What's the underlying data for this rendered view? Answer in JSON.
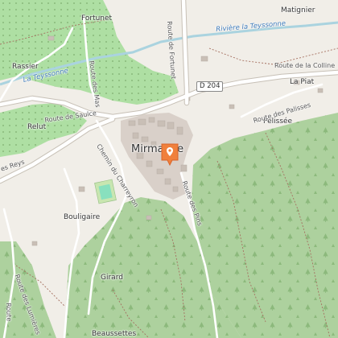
{
  "map": {
    "places": {
      "fortunet": "Fortunet",
      "matignier": "Matignier",
      "rassier": "Rassier",
      "la_piat": "La Piat",
      "pelissee": "Pelissée",
      "relut": "Relut",
      "mirmande": "Mirmande",
      "bouligaire": "Bouligaire",
      "girard": "Girard",
      "beaussettes": "Beaussettes"
    },
    "roads": {
      "route_fortunet": "Route de Fortunet",
      "route_collines": "Route de la Colline",
      "route_palisses": "Route des Palisses",
      "route_mas": "Route des Mas",
      "route_saulce": "Route de Saulce",
      "chemin_charreyron": "Chemin du Charreyron",
      "route_pins": "Route des Pins",
      "route_reys": "es Reys",
      "route_lumieres": "Route des Lumières",
      "route_left": "Route"
    },
    "shield": "D 204",
    "water": {
      "teyssonne_east": "Rivière la Teyssonne",
      "teyssonne_west": "La Teyssonne"
    },
    "marker_icon": "location-pin-icon",
    "colors": {
      "land": "#f1eee8",
      "vineyard": "#aedfa3",
      "forest": "#add19e",
      "water": "#aad3df",
      "road_major": "#ffffff",
      "marker": "#f0803c"
    }
  }
}
